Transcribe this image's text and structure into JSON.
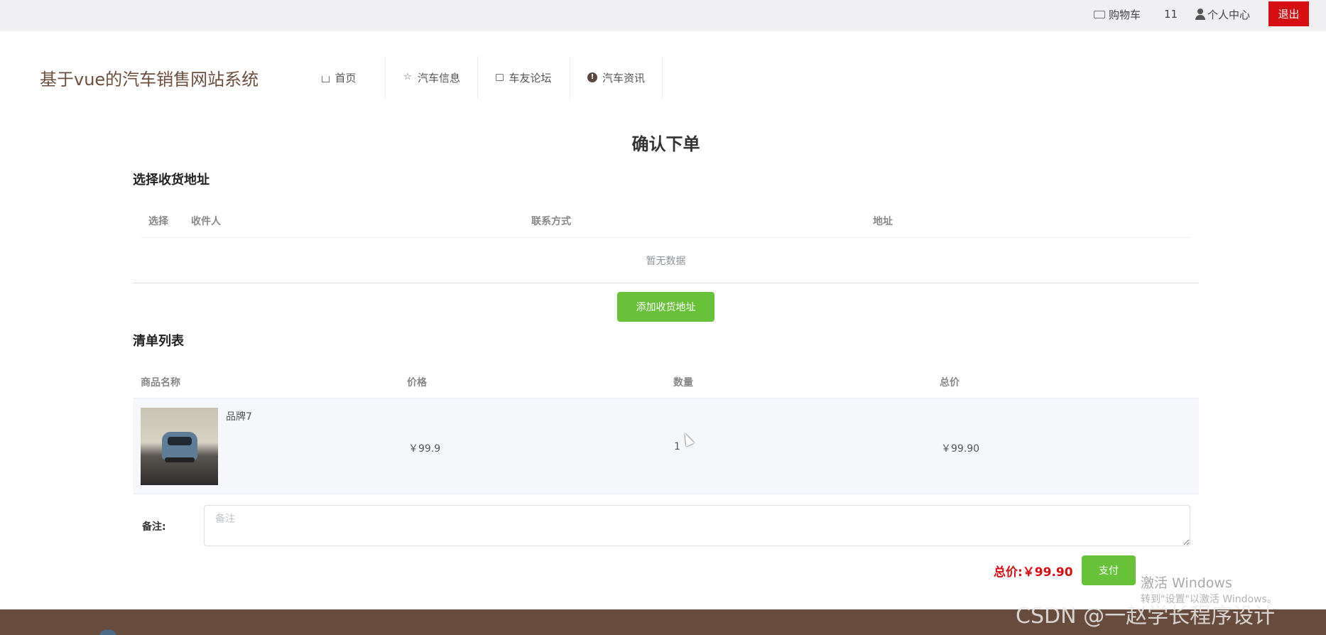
{
  "topbar": {
    "cart_label": "购物车",
    "user_name": "11",
    "profile_label": "个人中心",
    "logout_label": "退出"
  },
  "header": {
    "site_title": "基于vue的汽车销售网站系统",
    "nav": [
      {
        "label": "首页",
        "icon": "home-icon"
      },
      {
        "label": "汽车信息",
        "icon": "star-icon"
      },
      {
        "label": "车友论坛",
        "icon": "bag-icon"
      },
      {
        "label": "汽车资讯",
        "icon": "info-icon"
      }
    ]
  },
  "main": {
    "page_title": "确认下单",
    "address_section": {
      "title": "选择收货地址",
      "columns": [
        "选择",
        "收件人",
        "联系方式",
        "地址"
      ],
      "empty_text": "暂无数据",
      "add_button": "添加收货地址"
    },
    "list_section": {
      "title": "清单列表",
      "columns": [
        "商品名称",
        "价格",
        "数量",
        "总价"
      ],
      "rows": [
        {
          "name": "品牌7",
          "price": "￥99.9",
          "quantity": "1",
          "subtotal": "￥99.90"
        }
      ]
    },
    "remark": {
      "label": "备注:",
      "placeholder": "备注",
      "value": ""
    },
    "summary": {
      "total_text": "总价:￥99.90",
      "pay_button": "支付"
    }
  },
  "watermarks": {
    "windows_line1": "激活 Windows",
    "windows_line2": "转到\"设置\"以激活 Windows。",
    "csdn": "CSDN @一赵学长程序设计"
  },
  "colors": {
    "accent_green": "#67c23a",
    "danger_red": "#d60f13",
    "footer_brown": "#674c3e",
    "title_brown": "#6b4f3f"
  }
}
